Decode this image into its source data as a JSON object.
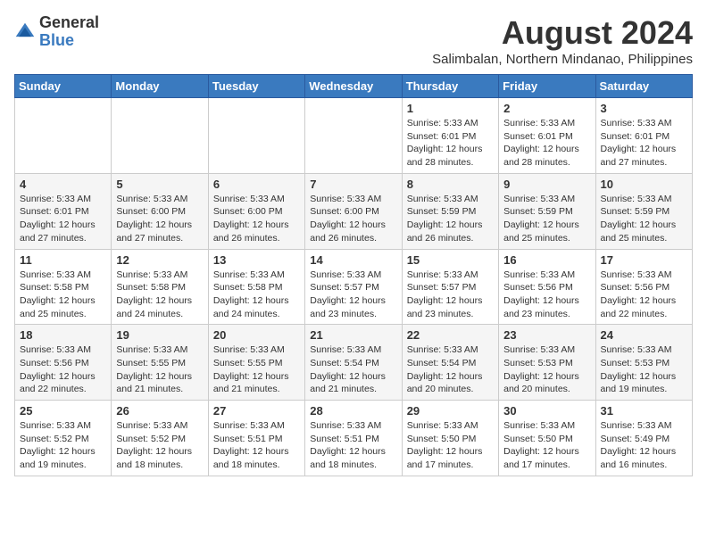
{
  "header": {
    "logo_line1": "General",
    "logo_line2": "Blue",
    "month_year": "August 2024",
    "location": "Salimbalan, Northern Mindanao, Philippines"
  },
  "weekdays": [
    "Sunday",
    "Monday",
    "Tuesday",
    "Wednesday",
    "Thursday",
    "Friday",
    "Saturday"
  ],
  "weeks": [
    [
      {
        "day": "",
        "info": ""
      },
      {
        "day": "",
        "info": ""
      },
      {
        "day": "",
        "info": ""
      },
      {
        "day": "",
        "info": ""
      },
      {
        "day": "1",
        "info": "Sunrise: 5:33 AM\nSunset: 6:01 PM\nDaylight: 12 hours\nand 28 minutes."
      },
      {
        "day": "2",
        "info": "Sunrise: 5:33 AM\nSunset: 6:01 PM\nDaylight: 12 hours\nand 28 minutes."
      },
      {
        "day": "3",
        "info": "Sunrise: 5:33 AM\nSunset: 6:01 PM\nDaylight: 12 hours\nand 27 minutes."
      }
    ],
    [
      {
        "day": "4",
        "info": "Sunrise: 5:33 AM\nSunset: 6:01 PM\nDaylight: 12 hours\nand 27 minutes."
      },
      {
        "day": "5",
        "info": "Sunrise: 5:33 AM\nSunset: 6:00 PM\nDaylight: 12 hours\nand 27 minutes."
      },
      {
        "day": "6",
        "info": "Sunrise: 5:33 AM\nSunset: 6:00 PM\nDaylight: 12 hours\nand 26 minutes."
      },
      {
        "day": "7",
        "info": "Sunrise: 5:33 AM\nSunset: 6:00 PM\nDaylight: 12 hours\nand 26 minutes."
      },
      {
        "day": "8",
        "info": "Sunrise: 5:33 AM\nSunset: 5:59 PM\nDaylight: 12 hours\nand 26 minutes."
      },
      {
        "day": "9",
        "info": "Sunrise: 5:33 AM\nSunset: 5:59 PM\nDaylight: 12 hours\nand 25 minutes."
      },
      {
        "day": "10",
        "info": "Sunrise: 5:33 AM\nSunset: 5:59 PM\nDaylight: 12 hours\nand 25 minutes."
      }
    ],
    [
      {
        "day": "11",
        "info": "Sunrise: 5:33 AM\nSunset: 5:58 PM\nDaylight: 12 hours\nand 25 minutes."
      },
      {
        "day": "12",
        "info": "Sunrise: 5:33 AM\nSunset: 5:58 PM\nDaylight: 12 hours\nand 24 minutes."
      },
      {
        "day": "13",
        "info": "Sunrise: 5:33 AM\nSunset: 5:58 PM\nDaylight: 12 hours\nand 24 minutes."
      },
      {
        "day": "14",
        "info": "Sunrise: 5:33 AM\nSunset: 5:57 PM\nDaylight: 12 hours\nand 23 minutes."
      },
      {
        "day": "15",
        "info": "Sunrise: 5:33 AM\nSunset: 5:57 PM\nDaylight: 12 hours\nand 23 minutes."
      },
      {
        "day": "16",
        "info": "Sunrise: 5:33 AM\nSunset: 5:56 PM\nDaylight: 12 hours\nand 23 minutes."
      },
      {
        "day": "17",
        "info": "Sunrise: 5:33 AM\nSunset: 5:56 PM\nDaylight: 12 hours\nand 22 minutes."
      }
    ],
    [
      {
        "day": "18",
        "info": "Sunrise: 5:33 AM\nSunset: 5:56 PM\nDaylight: 12 hours\nand 22 minutes."
      },
      {
        "day": "19",
        "info": "Sunrise: 5:33 AM\nSunset: 5:55 PM\nDaylight: 12 hours\nand 21 minutes."
      },
      {
        "day": "20",
        "info": "Sunrise: 5:33 AM\nSunset: 5:55 PM\nDaylight: 12 hours\nand 21 minutes."
      },
      {
        "day": "21",
        "info": "Sunrise: 5:33 AM\nSunset: 5:54 PM\nDaylight: 12 hours\nand 21 minutes."
      },
      {
        "day": "22",
        "info": "Sunrise: 5:33 AM\nSunset: 5:54 PM\nDaylight: 12 hours\nand 20 minutes."
      },
      {
        "day": "23",
        "info": "Sunrise: 5:33 AM\nSunset: 5:53 PM\nDaylight: 12 hours\nand 20 minutes."
      },
      {
        "day": "24",
        "info": "Sunrise: 5:33 AM\nSunset: 5:53 PM\nDaylight: 12 hours\nand 19 minutes."
      }
    ],
    [
      {
        "day": "25",
        "info": "Sunrise: 5:33 AM\nSunset: 5:52 PM\nDaylight: 12 hours\nand 19 minutes."
      },
      {
        "day": "26",
        "info": "Sunrise: 5:33 AM\nSunset: 5:52 PM\nDaylight: 12 hours\nand 18 minutes."
      },
      {
        "day": "27",
        "info": "Sunrise: 5:33 AM\nSunset: 5:51 PM\nDaylight: 12 hours\nand 18 minutes."
      },
      {
        "day": "28",
        "info": "Sunrise: 5:33 AM\nSunset: 5:51 PM\nDaylight: 12 hours\nand 18 minutes."
      },
      {
        "day": "29",
        "info": "Sunrise: 5:33 AM\nSunset: 5:50 PM\nDaylight: 12 hours\nand 17 minutes."
      },
      {
        "day": "30",
        "info": "Sunrise: 5:33 AM\nSunset: 5:50 PM\nDaylight: 12 hours\nand 17 minutes."
      },
      {
        "day": "31",
        "info": "Sunrise: 5:33 AM\nSunset: 5:49 PM\nDaylight: 12 hours\nand 16 minutes."
      }
    ]
  ]
}
